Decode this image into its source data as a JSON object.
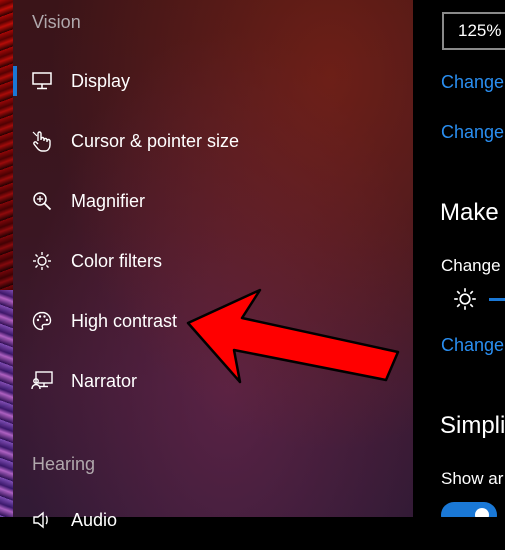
{
  "sidebar": {
    "vision_header": "Vision",
    "hearing_header": "Hearing",
    "items": [
      {
        "label": "Display",
        "icon": "display-icon"
      },
      {
        "label": "Cursor & pointer size",
        "icon": "cursor-hand-icon"
      },
      {
        "label": "Magnifier",
        "icon": "magnifier-icon"
      },
      {
        "label": "Color filters",
        "icon": "brightness-icon"
      },
      {
        "label": "High contrast",
        "icon": "palette-icon"
      },
      {
        "label": "Narrator",
        "icon": "narrator-icon"
      }
    ],
    "partial_item": {
      "label": "Audio",
      "icon": "speaker-icon"
    }
  },
  "main": {
    "scale_value": "125%",
    "change_link_1": "Change",
    "change_link_2": "Change",
    "make_heading": "Make",
    "change_text": "Change",
    "change_link_3": "Change",
    "simplify_heading": "Simpli",
    "show_text": "Show ar"
  },
  "colors": {
    "accent": "#1a78d6",
    "link": "#2a8ef0",
    "arrow": "#ff0000"
  }
}
